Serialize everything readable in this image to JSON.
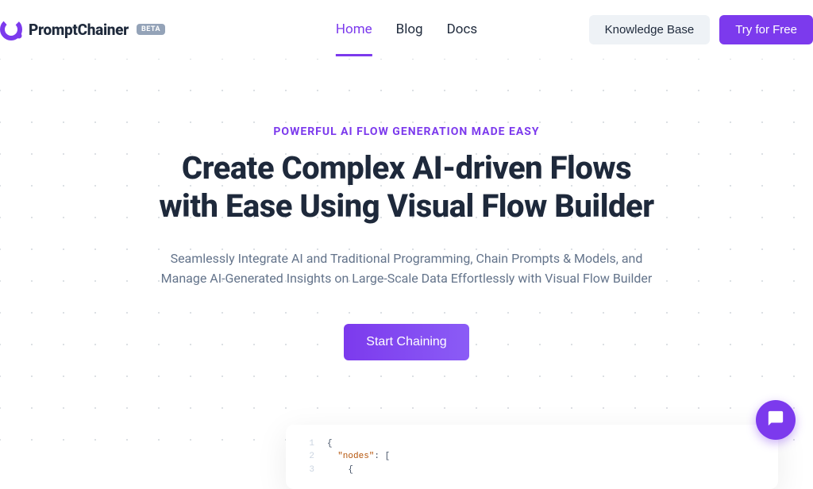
{
  "brand": {
    "name": "PromptChainer",
    "badge": "BETA"
  },
  "nav": {
    "items": [
      {
        "label": "Home",
        "active": true
      },
      {
        "label": "Blog",
        "active": false
      },
      {
        "label": "Docs",
        "active": false
      }
    ]
  },
  "header_actions": {
    "knowledge_base": "Knowledge Base",
    "try_free": "Try for Free"
  },
  "hero": {
    "eyebrow": "POWERFUL AI FLOW GENERATION MADE EASY",
    "title_line1": "Create Complex AI-driven Flows",
    "title_line2": "with Ease Using Visual Flow Builder",
    "subtitle": "Seamlessly Integrate AI and Traditional Programming, Chain Prompts & Models, and Manage AI-Generated Insights on Large-Scale Data Effortlessly with Visual Flow Builder",
    "cta": "Start Chaining"
  },
  "code_preview": {
    "lines": [
      {
        "num": "1",
        "indent": "",
        "content_type": "brace",
        "content": "{"
      },
      {
        "num": "2",
        "indent": "  ",
        "content_type": "keyline",
        "key": "\"nodes\"",
        "after": ": ["
      },
      {
        "num": "3",
        "indent": "    ",
        "content_type": "brace",
        "content": "{"
      }
    ]
  },
  "colors": {
    "accent": "#7c3aed"
  }
}
